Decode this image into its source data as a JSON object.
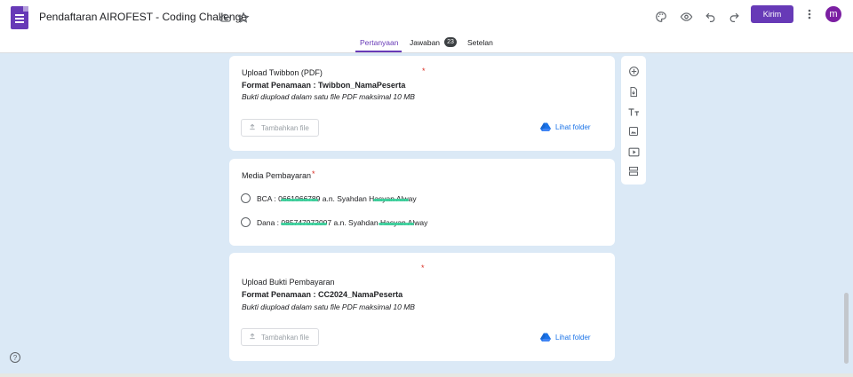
{
  "header": {
    "title": "Pendaftaran AIROFEST - Coding Challenge",
    "send_label": "Kirim",
    "avatar_letter": "m"
  },
  "tabs": [
    {
      "label": "Pertanyaan",
      "active": true
    },
    {
      "label": "Jawaban",
      "badge": "23"
    },
    {
      "label": "Setelan"
    }
  ],
  "cards": {
    "twibbon": {
      "title": "Upload Twibbon (PDF)",
      "required_mark": "*",
      "format": "Format Penamaan : Twibbon_NamaPeserta",
      "description": "Bukti diupload dalam satu file PDF maksimal 10 MB",
      "upload_label": "Tambahkan file",
      "folder_label": "Lihat folder"
    },
    "payment_media": {
      "title": "Media Pembayaran",
      "required_mark": "*",
      "options": [
        "BCA : 0661966789 a.n. Syahdan Hasyan Alway",
        "Dana : 085747972007 a.n. Syahdan Hasyan Alway"
      ]
    },
    "proof": {
      "title": "Upload Bukti Pembayaran",
      "required_mark": "*",
      "format": "Format Penamaan : CC2024_NamaPeserta",
      "description": "Bukti diupload dalam satu file PDF maksimal 10 MB",
      "upload_label": "Tambahkan file",
      "folder_label": "Lihat folder"
    }
  },
  "colors": {
    "accent": "#673ab7",
    "background": "#dbe9f6",
    "link": "#1a73e8",
    "required": "#d93025"
  }
}
